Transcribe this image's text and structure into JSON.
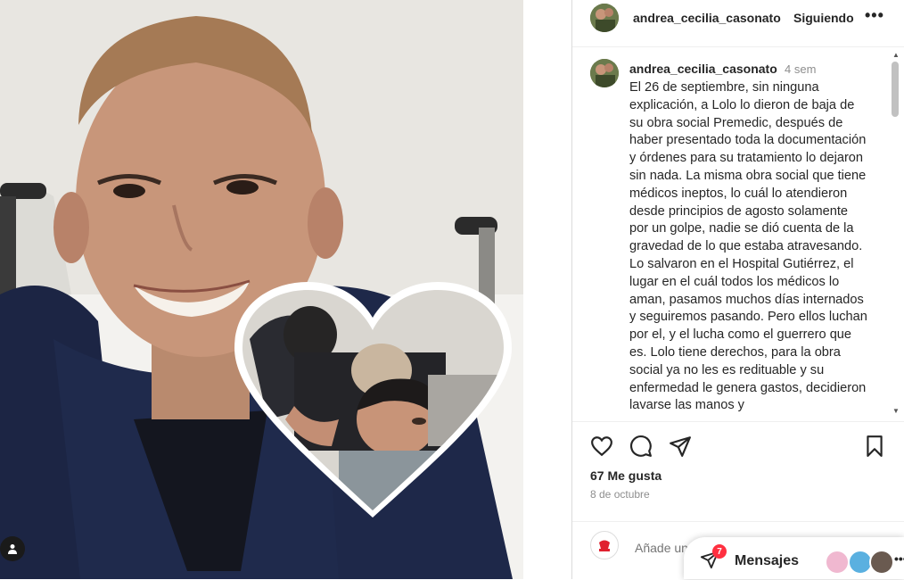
{
  "post": {
    "username": "andrea_cecilia_casonato",
    "follow_label": "Siguiendo",
    "more_label": "•••",
    "caption_time": "4 sem",
    "caption": "El 26 de septiembre, sin ninguna explicación, a Lolo lo dieron de baja de su obra social Premedic, después de haber presentado toda la documentación y órdenes para su tratamiento lo dejaron sin nada. La misma obra social que tiene médicos ineptos, lo cuál lo atendieron desde principios de agosto solamente por un golpe, nadie se dió cuenta de la gravedad de lo que estaba atravesando. Lo salvaron en el Hospital Gutiérrez, el lugar en el cuál todos los médicos lo aman, pasamos muchos días internados y seguiremos pasando. Pero ellos luchan por el, y el lucha como el guerrero que es. Lolo tiene derechos, para la obra social ya no les es redituable y su enfermedad le genera gastos, decidieron lavarse las manos y",
    "likes": "67 Me gusta",
    "date": "8 de octubre",
    "comment_placeholder": "Añade un"
  },
  "icons": {
    "like": "heart-icon",
    "comment": "comment-icon",
    "share": "share-icon",
    "save": "bookmark-icon",
    "user_tag": "user-tag-icon",
    "messages": "messages-icon"
  },
  "messages": {
    "label": "Mensajes",
    "badge": "7",
    "more": "•••"
  },
  "colors": {
    "badge": "#ff3040",
    "muted": "#8e8e8e",
    "text": "#262626"
  }
}
